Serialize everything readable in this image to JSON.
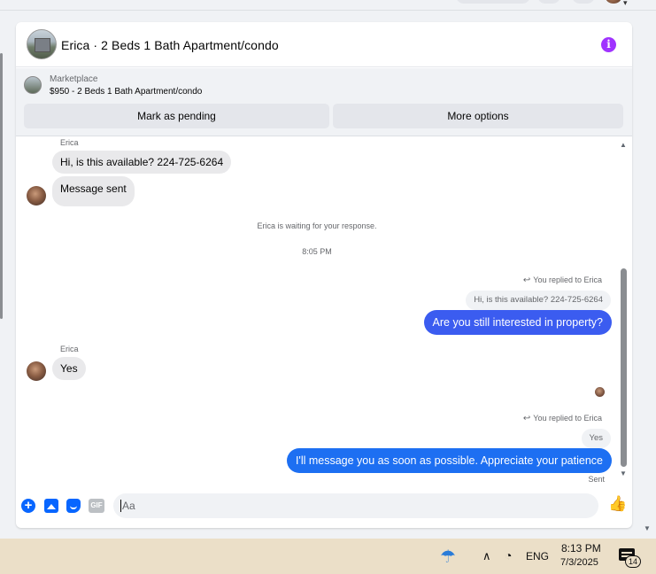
{
  "header": {
    "title": "Erica · 2 Beds 1 Bath Apartment/condo",
    "info_icon": "info-icon"
  },
  "marketplace": {
    "label": "Marketplace",
    "listing": "$950 - 2 Beds 1 Bath Apartment/condo",
    "mark_pending_label": "Mark as pending",
    "more_options_label": "More options"
  },
  "conversation": {
    "sender_name_1": "Erica",
    "msg_1": "Hi, is this available? 224-725-6264",
    "msg_2": "Message sent",
    "waiting_note": "Erica is waiting for your response.",
    "timestamp": "8:05 PM",
    "reply_indicator_1": "You replied to Erica",
    "quoted_1": "Hi, is this available? 224-725-6264",
    "out_1": "Are you still interested in property?",
    "sender_name_2": "Erica",
    "msg_3": "Yes",
    "reply_indicator_2": "You replied to Erica",
    "quoted_2": "Yes",
    "out_2": "I'll message you as soon as possible. Appreciate your patience",
    "status": "Sent"
  },
  "composer": {
    "placeholder": "Aa",
    "gif_label": "GIF"
  },
  "taskbar": {
    "language": "ENG",
    "time": "8:13 PM",
    "date": "7/3/2025",
    "notification_count": "14"
  },
  "colors": {
    "outgoing_bubble": "#3b5cf0",
    "outgoing_bubble_recent": "#1d6ff2",
    "accent": "#0866ff",
    "info": "#a033ff",
    "taskbar": "#ebdfc8"
  }
}
